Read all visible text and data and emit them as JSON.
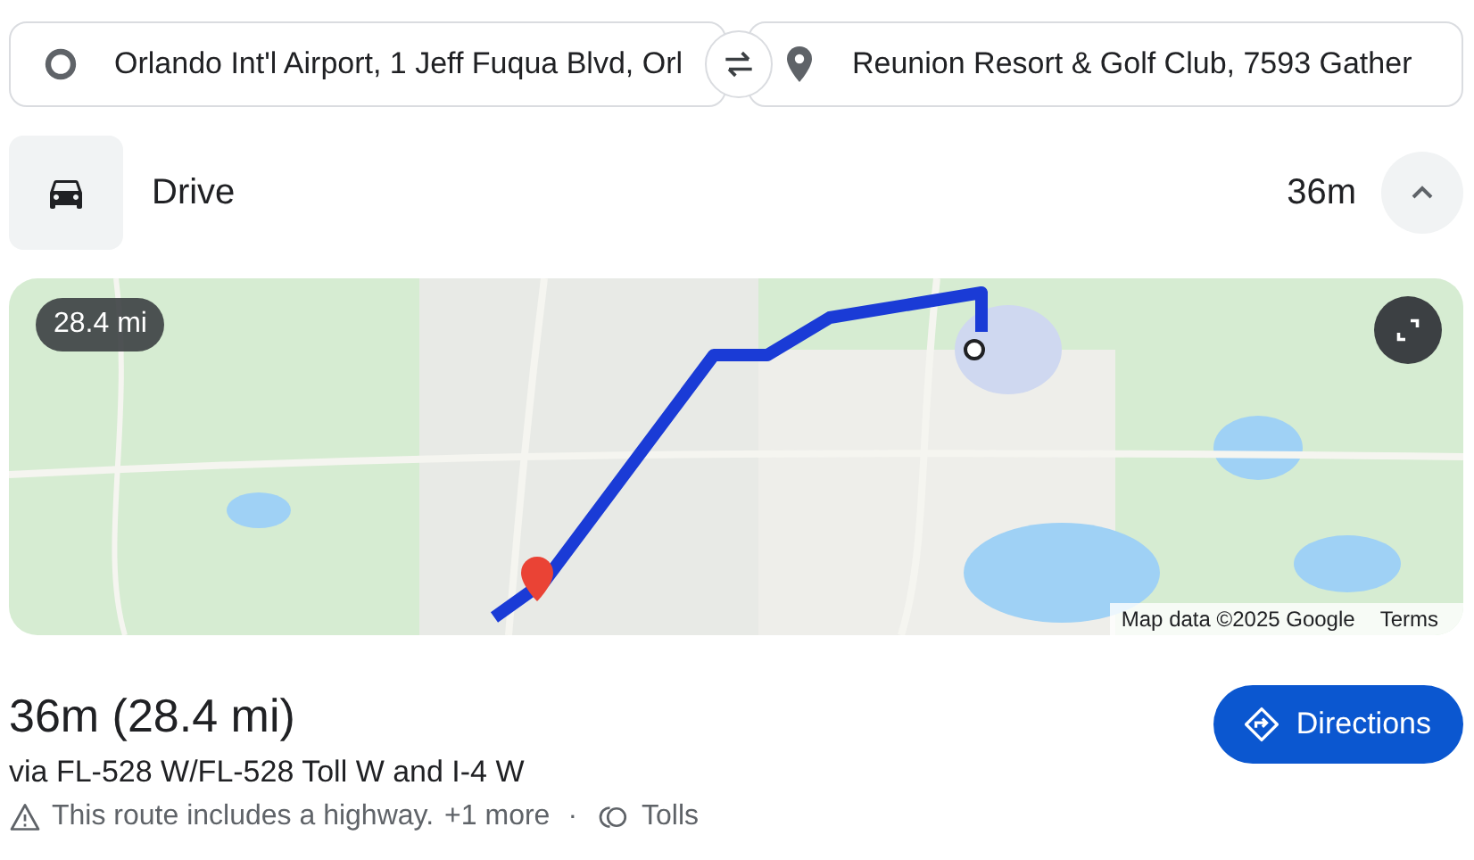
{
  "origin": {
    "value": "Orlando Int'l Airport, 1 Jeff Fuqua Blvd, Orl"
  },
  "destination": {
    "value": "Reunion Resort & Golf Club, 7593 Gather"
  },
  "mode": {
    "label": "Drive",
    "duration": "36m",
    "expanded": true
  },
  "map": {
    "kind": "picture",
    "distance_badge": "28.4 mi",
    "attribution": "Map data ©2025 Google",
    "terms": "Terms"
  },
  "summary": {
    "title": "36m (28.4 mi)",
    "via": "via FL-528 W/FL-528 Toll W and I-4 W",
    "warning": "This route includes a highway.",
    "more": "+1 more",
    "separator": "·",
    "tolls": "Tolls"
  },
  "buttons": [
    {
      "label": "Directions"
    }
  ]
}
